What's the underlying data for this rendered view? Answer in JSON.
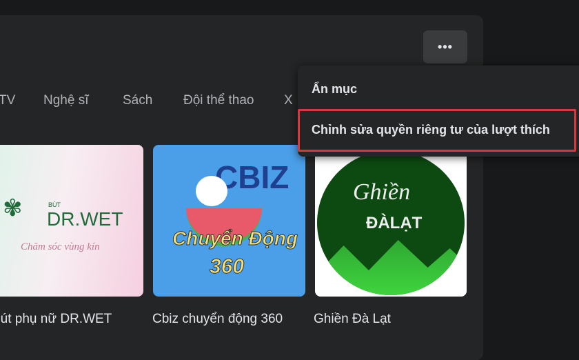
{
  "header": {
    "more_button": "•••"
  },
  "tabs": [
    {
      "label": "TV"
    },
    {
      "label": "Nghệ sĩ"
    },
    {
      "label": "Sách"
    },
    {
      "label": "Đội thể thao"
    },
    {
      "label": "X"
    }
  ],
  "items": [
    {
      "title": "Bút phụ nữ DR.WET",
      "logo_text": "DR.WET",
      "logo_small": "BÚT",
      "tagline": "Chăm sóc vùng kín"
    },
    {
      "title": "Cbiz chuyển động 360",
      "logo_text": "CBIZ",
      "tagline": "Chuyển Động",
      "number": "360"
    },
    {
      "title": "Ghiền Đà Lạt",
      "logo_script": "Ghiền",
      "logo_text": "ĐÀLẠT"
    }
  ],
  "menu": {
    "items": [
      {
        "label": "Ẩn mục"
      },
      {
        "label": "Chỉnh sửa quyền riêng tư của lượt thích"
      }
    ],
    "highlight_color": "#d9363e"
  }
}
